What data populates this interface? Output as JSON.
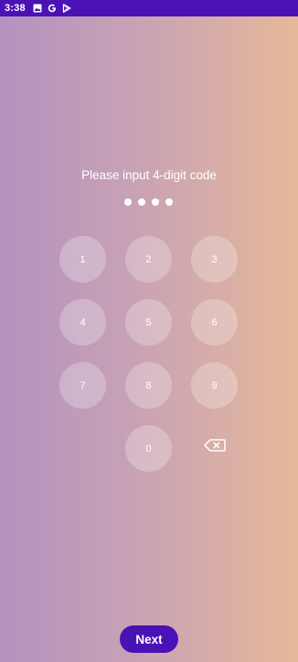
{
  "status_bar": {
    "time": "3:38",
    "icons": [
      "image-icon",
      "google-icon",
      "play-store-icon"
    ],
    "background_color": "#4a12b4"
  },
  "prompt": "Please input 4-digit code",
  "entered_digits_count": 4,
  "keypad": {
    "keys": [
      "1",
      "2",
      "3",
      "4",
      "5",
      "6",
      "7",
      "8",
      "9",
      "0"
    ],
    "backspace_icon": "backspace-icon"
  },
  "next_button": {
    "label": "Next",
    "color": "#4a12b4"
  },
  "colors": {
    "gradient_start": "#b392bf",
    "gradient_end": "#e6b89a"
  }
}
